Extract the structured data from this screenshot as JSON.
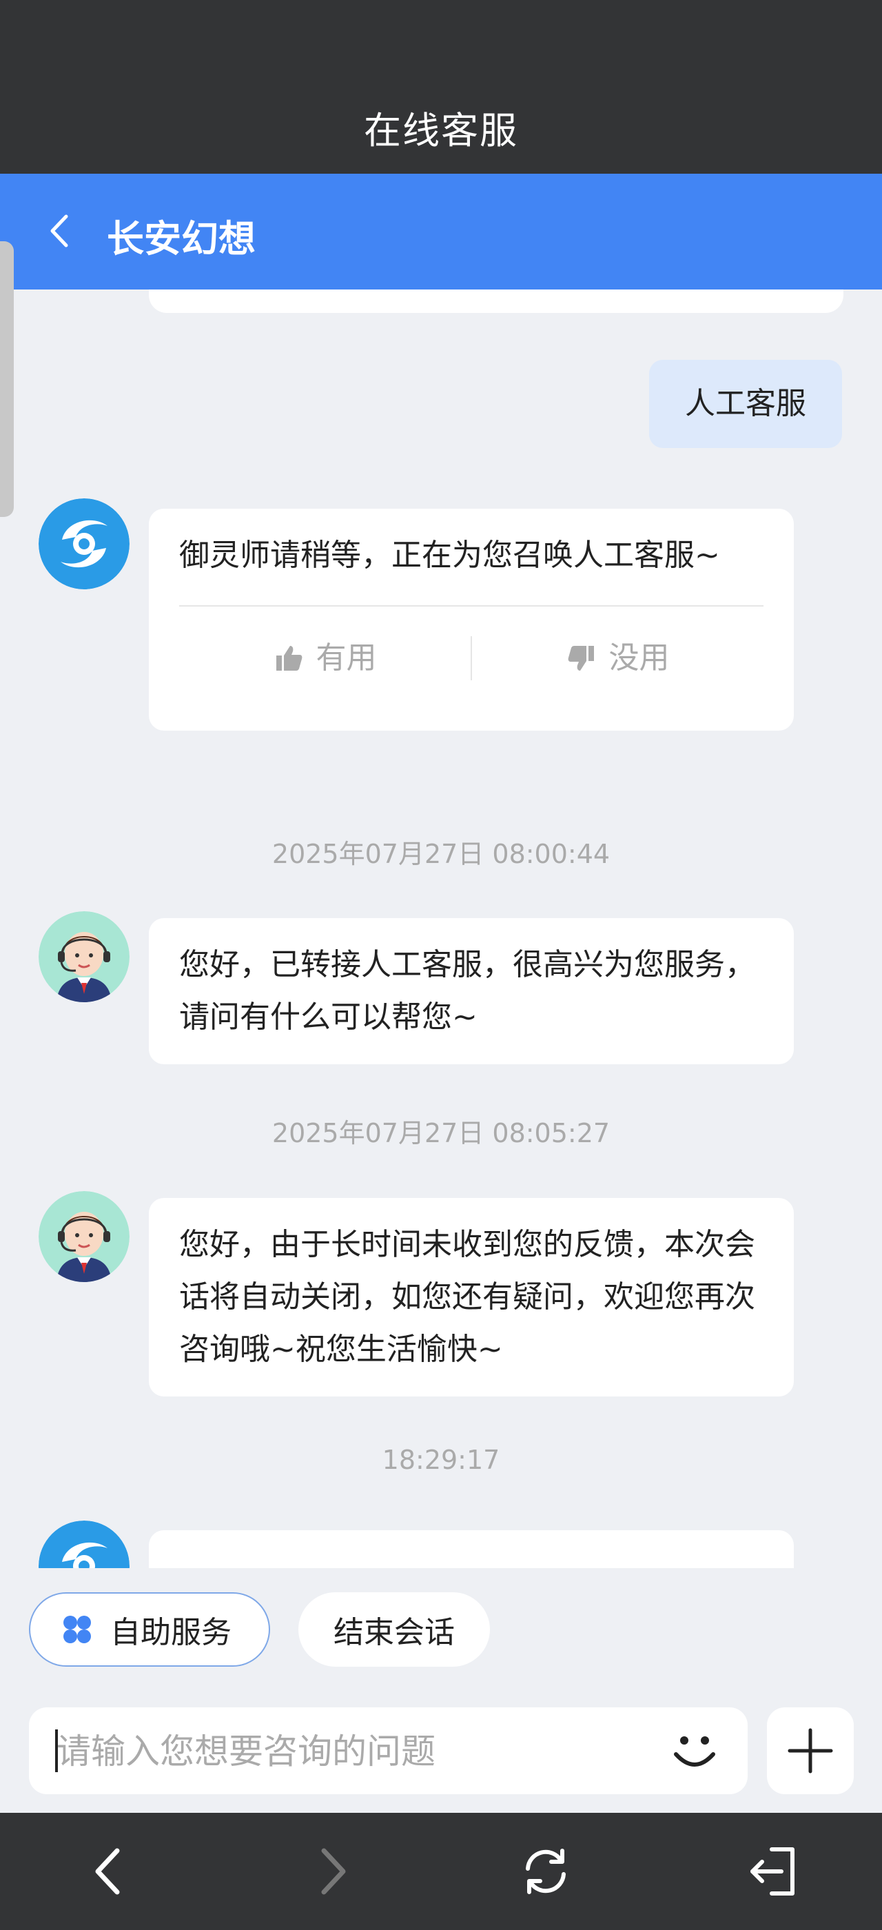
{
  "header": {
    "title": "在线客服"
  },
  "nav": {
    "game_title": "长安幻想"
  },
  "messages": {
    "user_message": "人工客服",
    "bot_reply": "御灵师请稍等，正在为您召唤人工客服~",
    "feedback_useful": "有用",
    "feedback_useless": "没用",
    "timestamp1": "2025年07月27日 08:00:44",
    "agent_msg1": "您好，已转接人工客服，很高兴为您服务，请问有什么可以帮您~",
    "timestamp2": "2025年07月27日 08:05:27",
    "agent_msg2": "您好，由于长时间未收到您的反馈，本次会话将自动关闭，如您还有疑问，欢迎您再次咨询哦~祝您生活愉快~",
    "timestamp3": "18:29:17"
  },
  "quick_actions": {
    "self_service": "自助服务",
    "end_session": "结束会话"
  },
  "input": {
    "placeholder": "请输入您想要咨询的问题"
  },
  "icons": {
    "back": "chevron-left-icon",
    "bot_avatar": "game-logo-icon",
    "agent_avatar": "agent-avatar-icon",
    "thumbs_up": "thumbs-up-icon",
    "thumbs_down": "thumbs-down-icon",
    "self_service": "grid-icon",
    "emoji": "smiley-icon",
    "plus": "plus-icon",
    "sys_back": "arrow-left-icon",
    "sys_forward": "arrow-right-icon",
    "sys_refresh": "refresh-icon",
    "sys_exit": "exit-icon"
  },
  "colors": {
    "accent": "#4285f4",
    "dark_bar": "#333436",
    "background": "#eef0f4"
  }
}
